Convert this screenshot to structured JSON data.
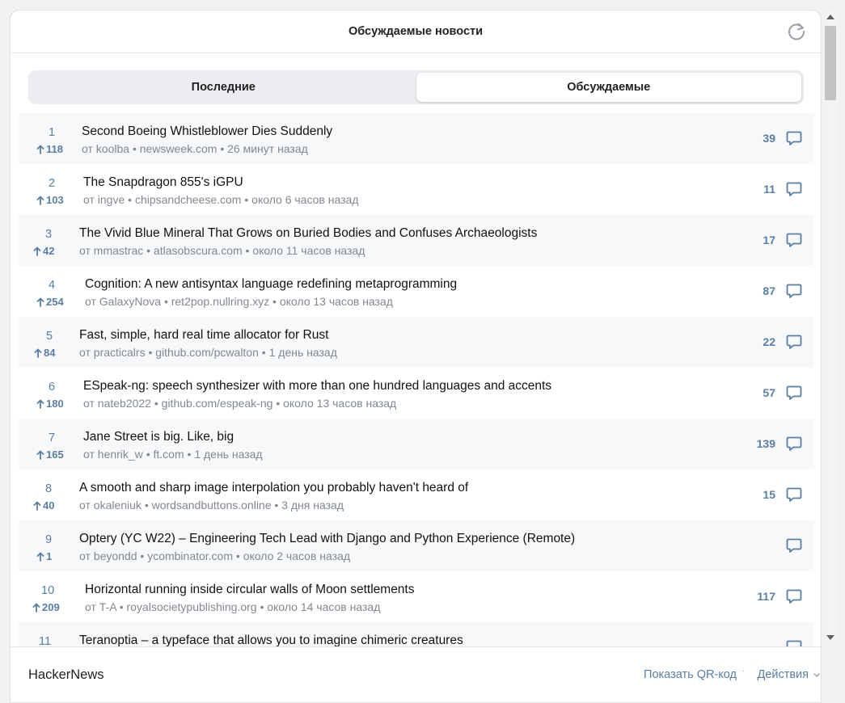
{
  "header": {
    "title": "Обсуждаемые новости"
  },
  "tabs": [
    {
      "label": "Последние",
      "active": false
    },
    {
      "label": "Обсуждаемые",
      "active": true
    }
  ],
  "stories": [
    {
      "rank": "1",
      "score": "118",
      "title": "Second Boeing Whistleblower Dies Suddenly",
      "author": "koolba",
      "domain": "newsweek.com",
      "age": "26 минут назад",
      "comments": "39"
    },
    {
      "rank": "2",
      "score": "103",
      "title": "The Snapdragon 855's iGPU",
      "author": "ingve",
      "domain": "chipsandcheese.com",
      "age": "около 6 часов назад",
      "comments": "11"
    },
    {
      "rank": "3",
      "score": "42",
      "title": "The Vivid Blue Mineral That Grows on Buried Bodies and Confuses Archaeologists",
      "author": "mmastrac",
      "domain": "atlasobscura.com",
      "age": "около 11 часов назад",
      "comments": "17"
    },
    {
      "rank": "4",
      "score": "254",
      "title": "Cognition: A new antisyntax language redefining metaprogramming",
      "author": "GalaxyNova",
      "domain": "ret2pop.nullring.xyz",
      "age": "около 13 часов назад",
      "comments": "87"
    },
    {
      "rank": "5",
      "score": "84",
      "title": "Fast, simple, hard real time allocator for Rust",
      "author": "practicalrs",
      "domain": "github.com/pcwalton",
      "age": "1 день назад",
      "comments": "22"
    },
    {
      "rank": "6",
      "score": "180",
      "title": "ESpeak-ng: speech synthesizer with more than one hundred languages and accents",
      "author": "nateb2022",
      "domain": "github.com/espeak-ng",
      "age": "около 13 часов назад",
      "comments": "57"
    },
    {
      "rank": "7",
      "score": "165",
      "title": "Jane Street is big. Like, big",
      "author": "henrik_w",
      "domain": "ft.com",
      "age": "1 день назад",
      "comments": "139"
    },
    {
      "rank": "8",
      "score": "40",
      "title": "A smooth and sharp image interpolation you probably haven't heard of",
      "author": "okaleniuk",
      "domain": "wordsandbuttons.online",
      "age": "3 дня назад",
      "comments": "15"
    },
    {
      "rank": "9",
      "score": "1",
      "title": "Optery (YC W22) – Engineering Tech Lead with Django and Python Experience (Remote)",
      "author": "beyondd",
      "domain": "ycombinator.com",
      "age": "около 2 часов назад",
      "comments": ""
    },
    {
      "rank": "10",
      "score": "209",
      "title": "Horizontal running inside circular walls of Moon settlements",
      "author": "T-A",
      "domain": "royalsocietypublishing.org",
      "age": "около 14 часов назад",
      "comments": "117"
    },
    {
      "rank": "11",
      "score": "",
      "title": "Teranoptia – a typeface that allows you to imagine chimeric creatures",
      "author": "",
      "domain": "",
      "age": "",
      "comments": ""
    }
  ],
  "meta_prefix": "от",
  "meta_sep": "•",
  "footer": {
    "brand": "HackerNews",
    "qr_label": "Показать QR-код",
    "actions_label": "Действия"
  },
  "colors": {
    "accent": "#5a7ea3",
    "meta": "#818891"
  },
  "icons": {
    "refresh": "refresh-icon",
    "comment": "comment-icon",
    "upvote": "arrow-up-icon",
    "chevron": "chevron-down-icon"
  }
}
